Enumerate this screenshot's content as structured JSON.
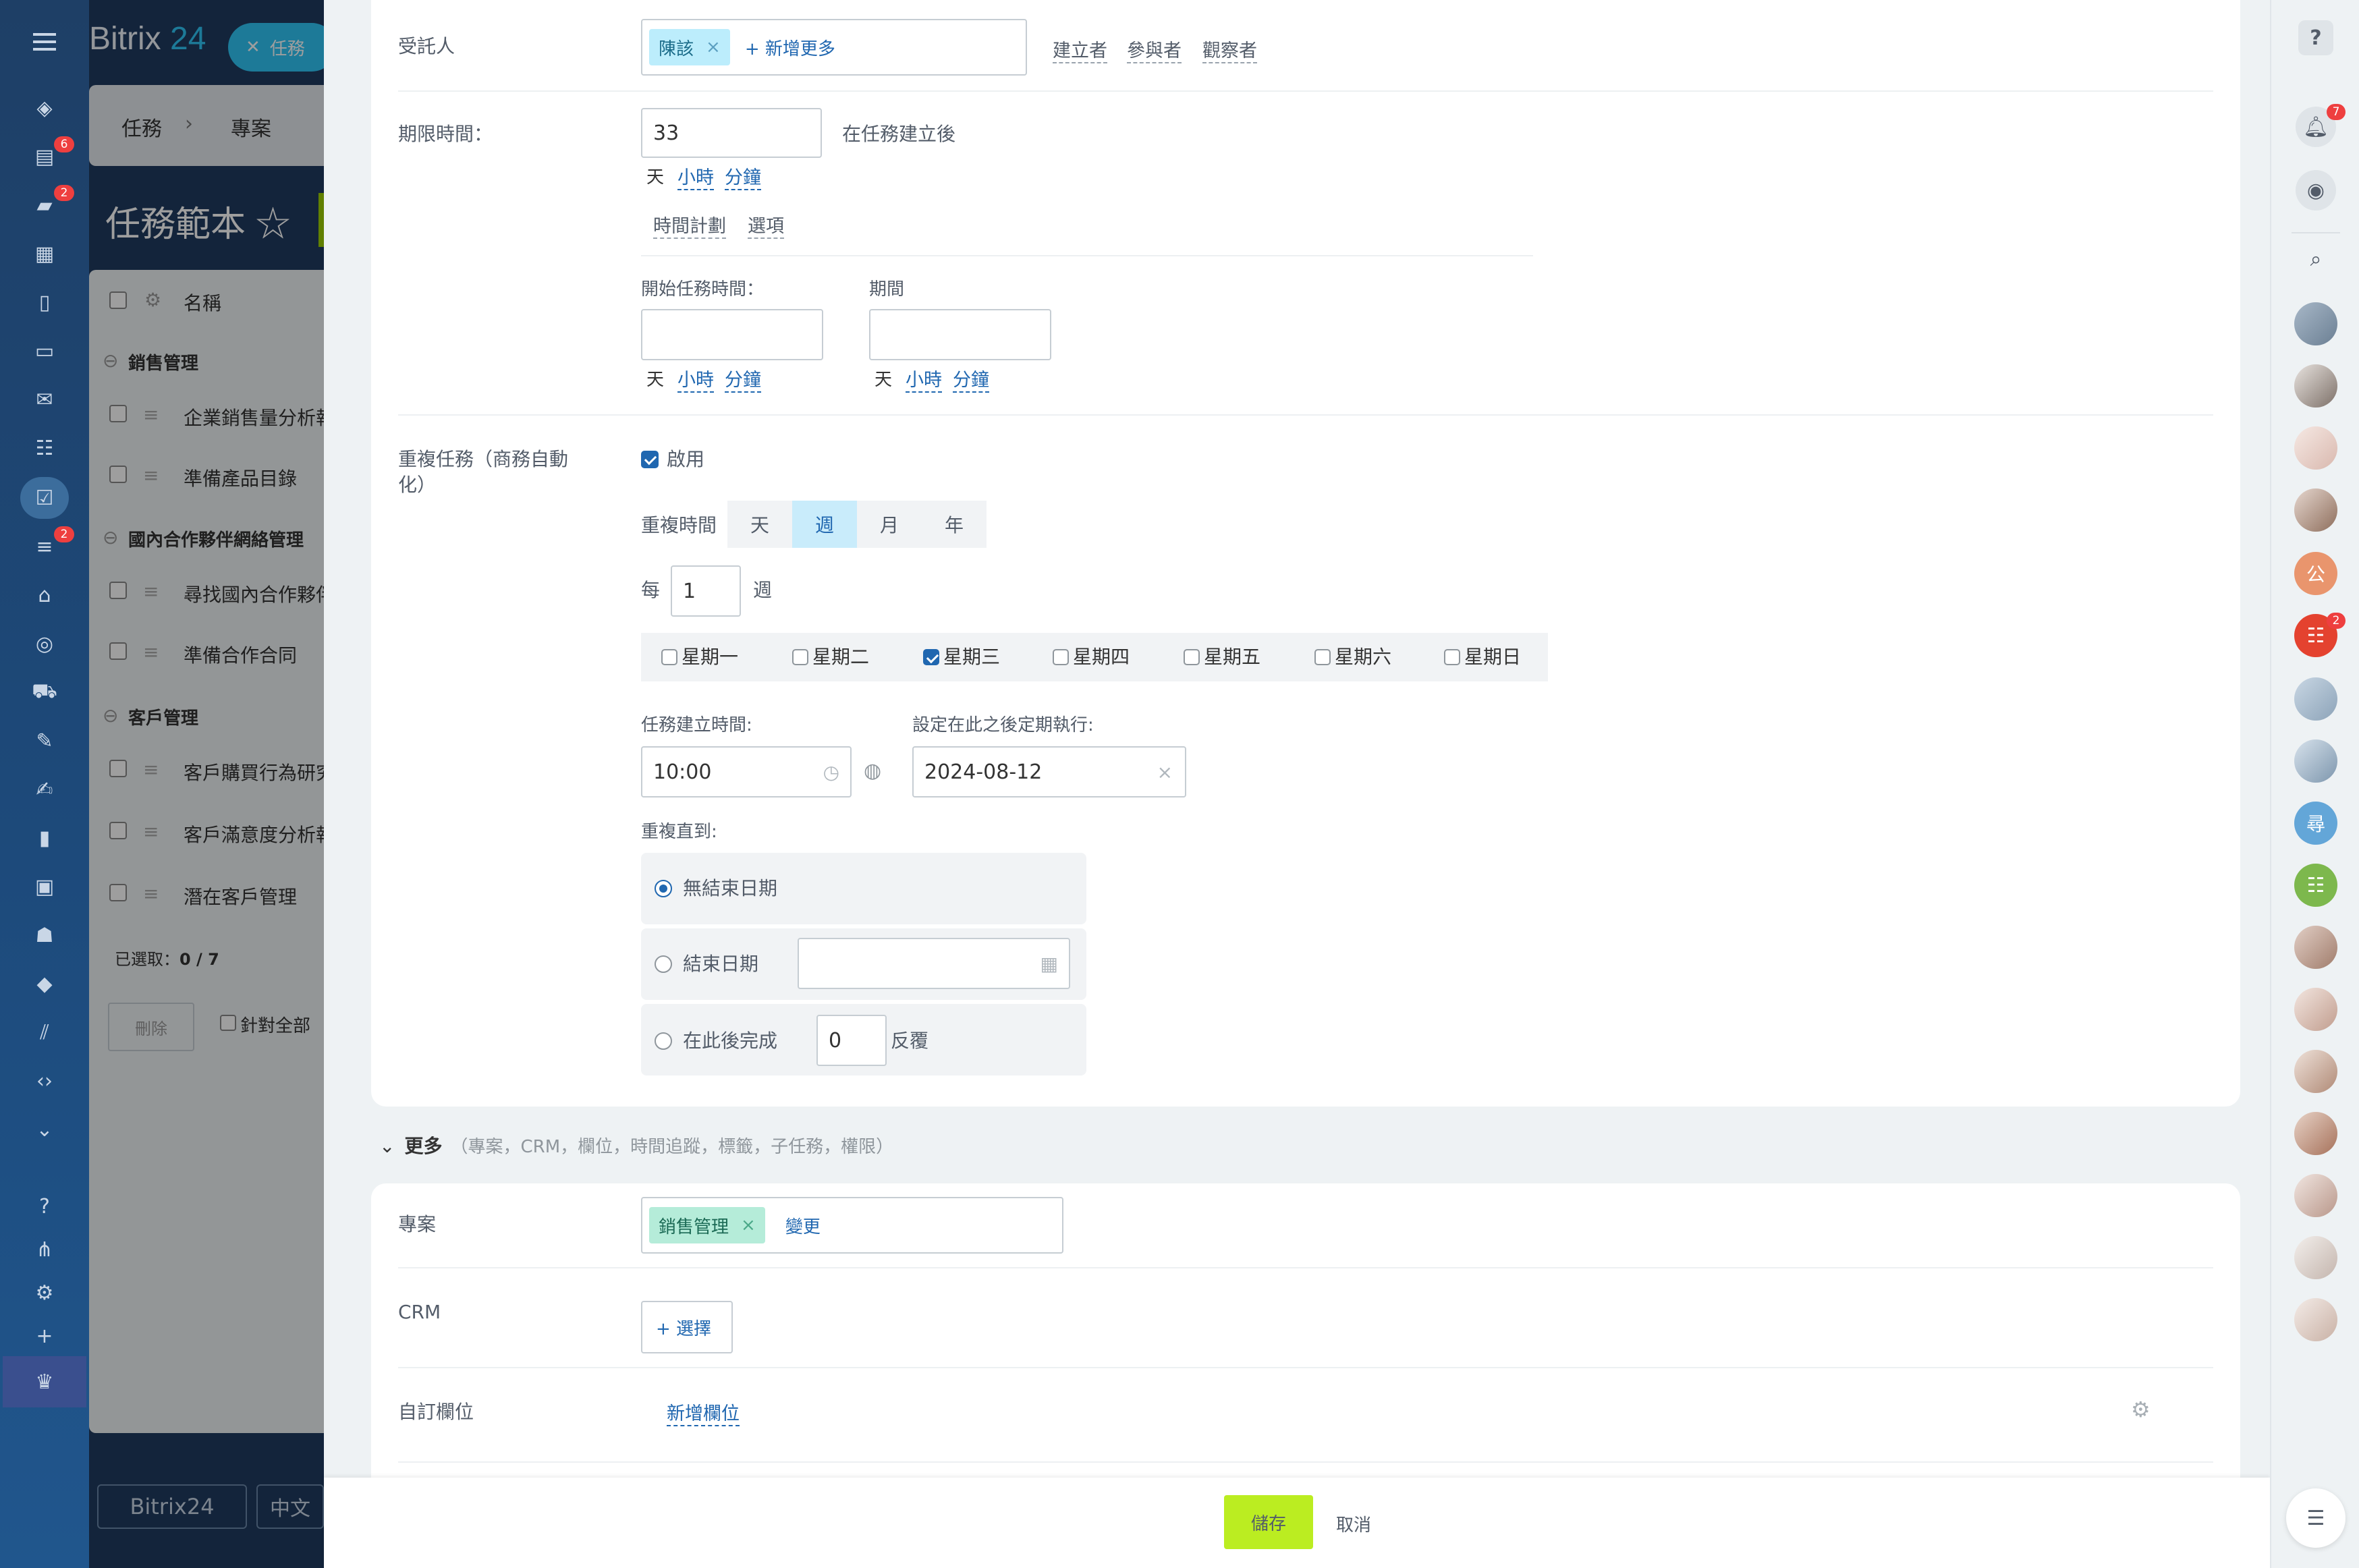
{
  "app": {
    "brand_name": "Bitrix",
    "brand_num": "24",
    "pill_label": "任務"
  },
  "left_nav": {
    "badges": {
      "badge1": "6",
      "badge2": "2",
      "badge3": "2"
    },
    "bottom_brand": "Bitrix24",
    "bottom_lang": "中文",
    "icons": [
      "flow-icon",
      "feed-icon",
      "chat-icon",
      "calendar-icon",
      "docs-icon",
      "drive-icon",
      "mail-icon",
      "groups-icon",
      "tasks-icon",
      "crm-icon",
      "sites-icon",
      "target-icon",
      "shop-icon",
      "forms-icon",
      "sign-icon",
      "analytics-icon",
      "hr-icon",
      "bot-icon",
      "inventory-icon",
      "automation-icon",
      "developer-icon",
      "more-icon",
      "help-icon",
      "sitemap-icon",
      "settings-icon",
      "add-icon",
      "crown-icon"
    ]
  },
  "background": {
    "breadcrumb": [
      "任務",
      "專案"
    ],
    "page_title": "任務範本",
    "table_header": "名稱",
    "groups": [
      {
        "name": "銷售管理",
        "items": [
          "企業銷售量分析報",
          "準備產品目錄"
        ]
      },
      {
        "name": "國內合作夥伴網絡管理",
        "items": [
          "尋找國內合作夥伴",
          "準備合作合同"
        ]
      },
      {
        "name": "客戶管理",
        "items": [
          "客戶購買行為研究",
          "客戶滿意度分析報",
          "潛在客戶管理"
        ]
      }
    ],
    "selected_label": "已選取：",
    "selected_value": "0 / 7",
    "delete_label": "刪除",
    "apply_all_label": "針對全部"
  },
  "form": {
    "assignee": {
      "label": "受託人",
      "tag": "陳該",
      "add_more": "+ 新增更多",
      "links": [
        "建立者",
        "參與者",
        "觀察者"
      ]
    },
    "deadline": {
      "label": "期限時間：",
      "value": "33",
      "suffix": "在任務建立後",
      "units": [
        "天",
        "小時",
        "分鐘"
      ]
    },
    "plan_tabs": [
      "時間計劃",
      "選項"
    ],
    "start": {
      "label": "開始任務時間：",
      "value": "",
      "units": [
        "天",
        "小時",
        "分鐘"
      ]
    },
    "duration": {
      "label": "期間",
      "value": "",
      "units": [
        "天",
        "小時",
        "分鐘"
      ]
    },
    "repeat": {
      "label": "重複任務（商務自動化）",
      "enabled_label": "啟用",
      "enabled": true,
      "period_label": "重複時間",
      "periods": [
        "天",
        "週",
        "月",
        "年"
      ],
      "active_period": "週",
      "every_label": "每",
      "every_value": "1",
      "every_unit": "週",
      "weekdays": [
        "星期一",
        "星期二",
        "星期三",
        "星期四",
        "星期五",
        "星期六",
        "星期日"
      ],
      "checked_day": "星期三",
      "create_time_label": "任務建立時間:",
      "create_time": "10:00",
      "after_label": "設定在此之後定期執行:",
      "after_date": "2024-08-12",
      "until_label": "重複直到:",
      "until_options": [
        "無結束日期",
        "結束日期",
        "在此後完成"
      ],
      "until_selected": "無結束日期",
      "end_date_value": "",
      "repeat_count": "0",
      "repeat_count_unit": "反覆"
    },
    "more": {
      "label": "更多",
      "hint": "（專案，CRM，欄位，時間追蹤，標籤，子任務，權限）"
    },
    "project": {
      "label": "專案",
      "tag": "銷售管理",
      "change": "變更"
    },
    "crm": {
      "label": "CRM",
      "button": "+ 選擇"
    },
    "custom_fields": {
      "label": "自訂欄位",
      "add": "新增欄位"
    }
  },
  "footer": {
    "save": "儲存",
    "cancel": "取消"
  },
  "right_bar": {
    "help_icon": "?",
    "notify_badge": "7",
    "group_badge": "2",
    "avatar_initials": [
      "公",
      "尋"
    ],
    "avatar_colors": [
      "#e9956d",
      "#e4422f",
      "#63a6d8",
      "#7db84d"
    ]
  }
}
